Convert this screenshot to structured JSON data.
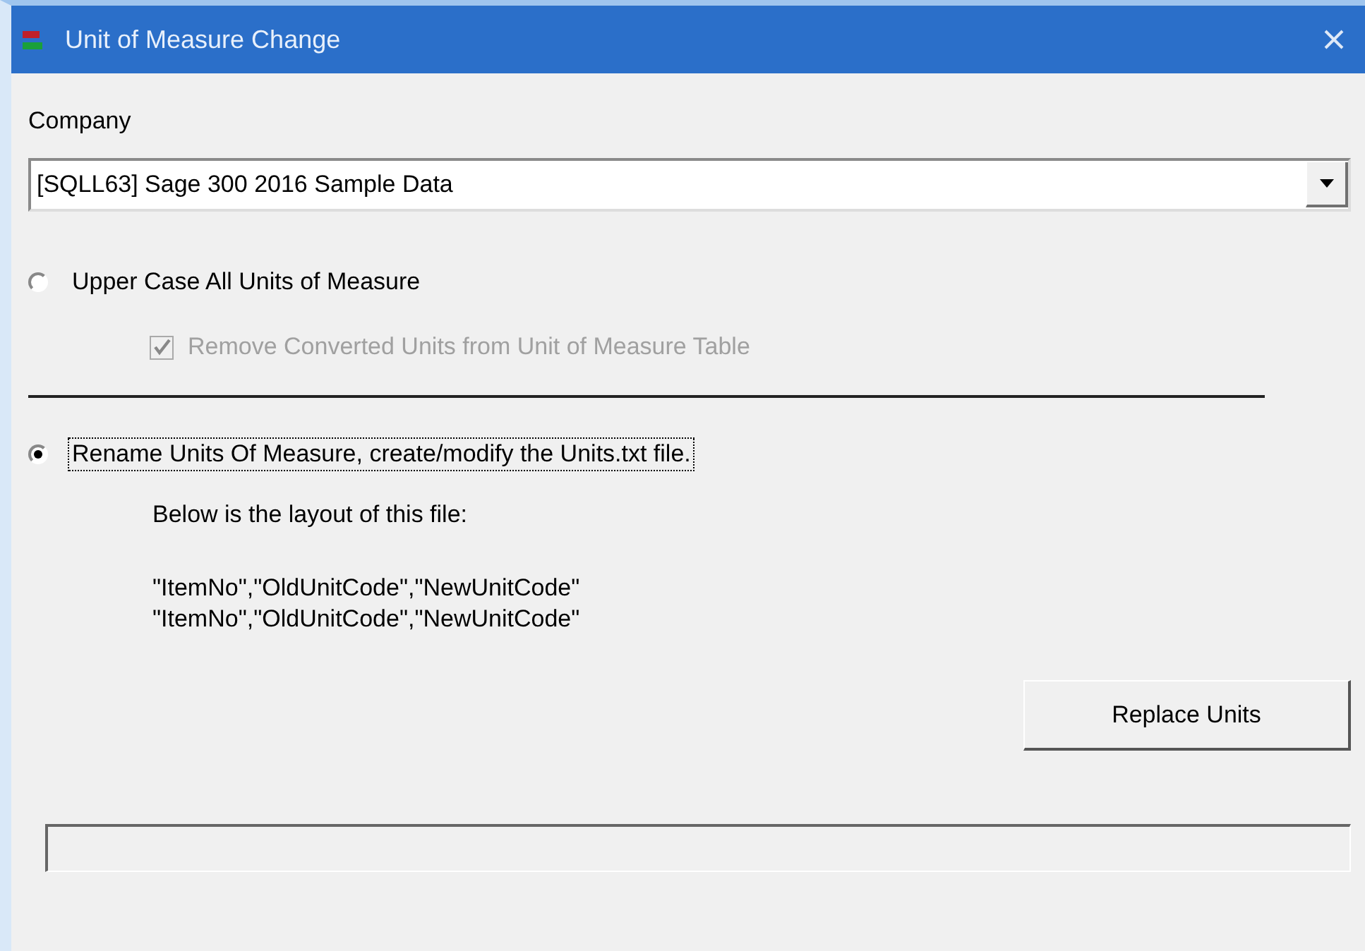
{
  "window": {
    "title": "Unit of Measure Change"
  },
  "company": {
    "label": "Company",
    "value": "[SQLL63] Sage 300 2016 Sample Data"
  },
  "options": [
    {
      "kind": "radio",
      "label": "Upper Case All Units of Measure",
      "selected": false,
      "focused": false
    },
    {
      "kind": "checkbox",
      "label": "Remove Converted Units from Unit of Measure Table",
      "checked": true,
      "disabled": true
    },
    {
      "kind": "divider"
    },
    {
      "kind": "radio",
      "label": "Rename Units Of Measure, create/modify the Units.txt file.",
      "selected": true,
      "focused": true
    }
  ],
  "notes": [
    {
      "text": "Below is the layout of this file:"
    },
    {
      "text": "\"ItemNo\",\"OldUnitCode\",\"NewUnitCode\""
    },
    {
      "text": "\"ItemNo\",\"OldUnitCode\",\"NewUnitCode\""
    }
  ],
  "replace_button": {
    "label": "Replace Units"
  }
}
